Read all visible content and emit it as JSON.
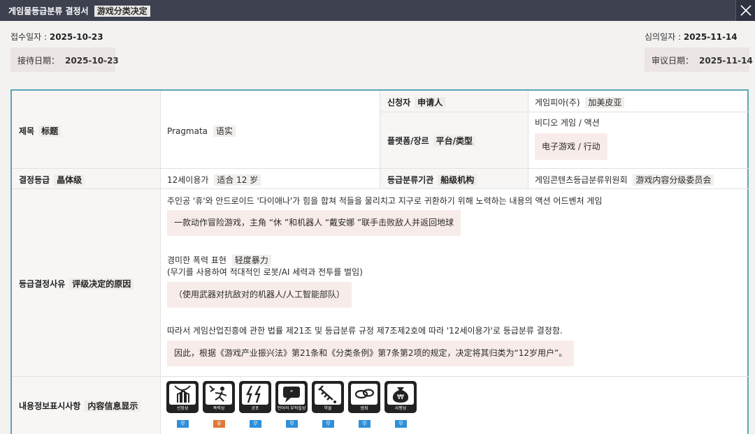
{
  "window": {
    "title": "게임물등급분류 결정서",
    "title_cn": "游戏分类决定"
  },
  "dates": {
    "received_label": "접수일자 :",
    "received_value": "2025-10-23",
    "received_label_cn": "接待日期：",
    "received_value_cn": "2025-10-23",
    "review_label": "심의일자 :",
    "review_value": "2025-11-14",
    "review_label_cn": "审议日期：",
    "review_value_cn": "2025-11-14"
  },
  "table": {
    "title_label": "제목",
    "title_label_cn": "标题",
    "title_value": "Pragmata",
    "title_value_cn": "语实",
    "applicant_label": "신청자",
    "applicant_label_cn": "申请人",
    "applicant_value": "게임피아(주)",
    "applicant_value_cn": "加美皮亚",
    "platform_label": "플랫폼/장르",
    "platform_label_cn": "平台/类型",
    "platform_value": "비디오 게임 /  액션",
    "platform_value_cn": "电子游戏  /  行动",
    "rating_label": "결정등급",
    "rating_label_cn": "晶体级",
    "rating_value": "12세이용가",
    "rating_value_cn": "适合 12 岁",
    "agency_label": "등급분류기관",
    "agency_label_cn": "船级机构",
    "agency_value": "게임콘텐츠등급분류위원회",
    "agency_value_cn": "游戏内容分级委员会",
    "reason_label": "등급결정사유",
    "reason_label_cn": "评级决定的原因",
    "reason_line1": "주인공 '휴'와 안드로이드 '다이애나'가 힘을 합쳐 적들을 물리치고 지구로 귀환하기 위해 노력하는 내용의 액션 어드벤처 게임",
    "reason_line1_cn": "一款动作冒险游戏，主角 “休 ”和机器人 “戴安娜 ”联手击败敌人并返回地球",
    "reason_line2": "경미한 폭력 표현",
    "reason_line2_cn": "轻度暴力",
    "reason_line3": "(무기를 사용하여 적대적인 로봇/AI 세력과 전투를 벌임)",
    "reason_line3_cn": "（使用武器对抗敌对的机器人/人工智能部队）",
    "reason_line4": "따라서 게임산업진흥에 관한 법률 제21조 및 등급분류 규정 제7조제2호에 따라 '12세이용가'로 등급분류 결정함.",
    "reason_line4_cn": "因此，根据《游戏产业振兴法》第21条和《分类条例》第7条第2项的规定，决定将其归类为“12岁用户”。",
    "content_label": "내용정보표시사항",
    "content_label_cn": "内容信息显示"
  },
  "content_icons": [
    {
      "name": "선정성",
      "mark": "무",
      "mark_color": "#2f8fd8",
      "icon": "sexuality-icon"
    },
    {
      "name": "폭력성",
      "mark": "유",
      "mark_color": "#e0773a",
      "icon": "violence-icon"
    },
    {
      "name": "공포",
      "mark": "무",
      "mark_color": "#2f8fd8",
      "icon": "fear-icon"
    },
    {
      "name": "언어의 부적절성",
      "mark": "무",
      "mark_color": "#2f8fd8",
      "icon": "language-icon"
    },
    {
      "name": "약물",
      "mark": "무",
      "mark_color": "#2f8fd8",
      "icon": "drug-icon"
    },
    {
      "name": "범죄",
      "mark": "무",
      "mark_color": "#2f8fd8",
      "icon": "crime-icon"
    },
    {
      "name": "사행성",
      "mark": "무",
      "mark_color": "#2f8fd8",
      "icon": "gambling-icon"
    }
  ]
}
